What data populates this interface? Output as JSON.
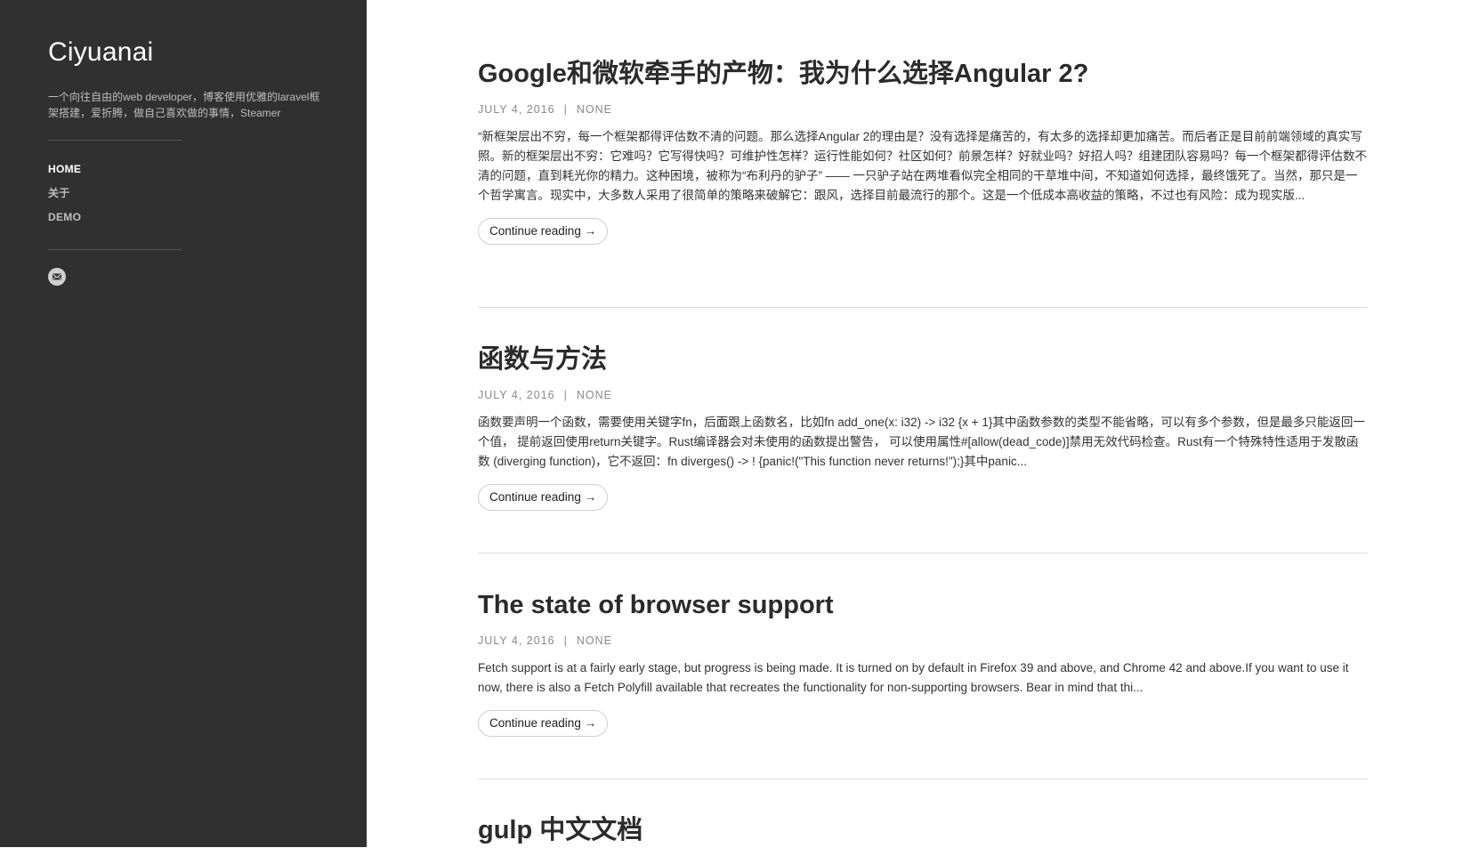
{
  "site": {
    "title": "Ciyuanai",
    "description": "一个向往自由的web developer，博客使用优雅的laravel框架搭建，爱折腾，做自己喜欢做的事情，Steamer"
  },
  "nav": {
    "items": [
      {
        "label": "HOME",
        "active": true
      },
      {
        "label": "关于",
        "active": false
      },
      {
        "label": "DEMO",
        "active": false
      }
    ]
  },
  "social": {
    "icon": "mail-icon"
  },
  "posts": [
    {
      "title": "Google和微软牵手的产物：我为什么选择Angular 2?",
      "date": "JULY 4, 2016",
      "separator": "|",
      "category": "NONE",
      "excerpt": "“新框架层出不穷，每一个框架都得评估数不清的问题。那么选择Angular 2的理由是？没有选择是痛苦的，有太多的选择却更加痛苦。而后者正是目前前端领域的真实写照。新的框架层出不穷：它难吗？它写得快吗？可维护性怎样？运行性能如何？社区如何？前景怎样？好就业吗？好招人吗？组建团队容易吗？每一个框架都得评估数不清的问题，直到耗光你的精力。这种困境，被称为“布利丹的驴子” —— 一只驴子站在两堆看似完全相同的干草堆中间，不知道如何选择，最终饿死了。当然，那只是一个哲学寓言。现实中，大多数人采用了很简单的策略来破解它：跟风，选择目前最流行的那个。这是一个低成本高收益的策略，不过也有风险：成为现实版...",
      "continue_label": "Continue reading →"
    },
    {
      "title": "函数与方法",
      "date": "JULY 4, 2016",
      "separator": "|",
      "category": "NONE",
      "excerpt": "函数要声明一个函数，需要使用关键字fn，后面跟上函数名，比如fn add_one(x: i32) -> i32 {x + 1}其中函数参数的类型不能省略，可以有多个参数，但是最多只能返回一个值， 提前返回使用return关键字。Rust编译器会对未使用的函数提出警告， 可以使用属性#[allow(dead_code)]禁用无效代码检查。Rust有一个特殊特性适用于发散函数 (diverging function)，它不返回：fn diverges() -> ! {panic!(\"This function never returns!\");}其中panic...",
      "continue_label": "Continue reading →"
    },
    {
      "title": "The state of browser support",
      "date": "JULY 4, 2016",
      "separator": "|",
      "category": "NONE",
      "excerpt": "Fetch support is at a fairly early stage, but progress is being made. It is turned on by default in Firefox 39 and above, and Chrome 42 and above.If you want to use it now, there is also a Fetch Polyfill available that recreates the functionality for non-supporting browsers. Bear in mind that thi...",
      "continue_label": "Continue reading →"
    },
    {
      "title": "gulp 中文文档"
    }
  ]
}
